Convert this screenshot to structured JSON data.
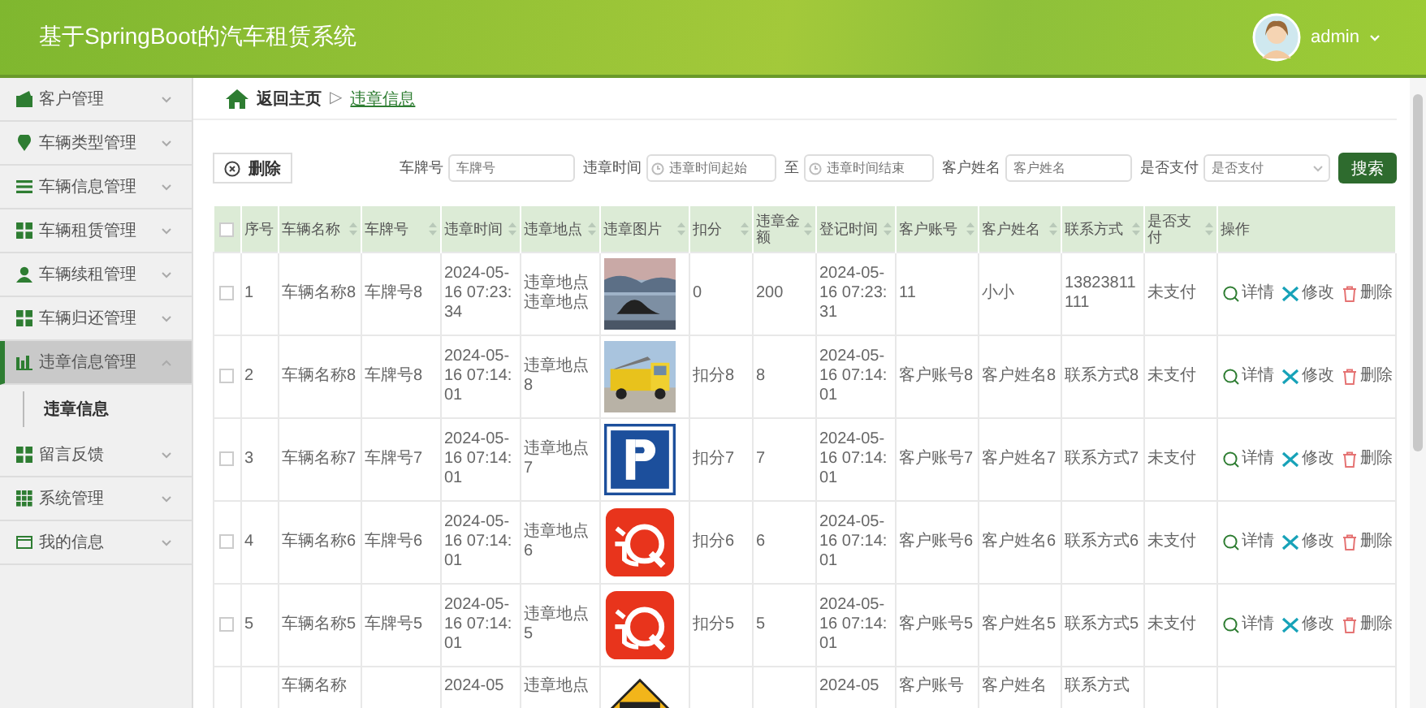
{
  "header": {
    "title": "基于SpringBoot的汽车租赁系统",
    "user": "admin"
  },
  "sidebar": {
    "items": [
      {
        "label": "客户管理",
        "expanded": false,
        "selected": false
      },
      {
        "label": "车辆类型管理",
        "expanded": false,
        "selected": false
      },
      {
        "label": "车辆信息管理",
        "expanded": false,
        "selected": false
      },
      {
        "label": "车辆租赁管理",
        "expanded": false,
        "selected": false
      },
      {
        "label": "车辆续租管理",
        "expanded": false,
        "selected": false
      },
      {
        "label": "车辆归还管理",
        "expanded": false,
        "selected": false
      },
      {
        "label": "违章信息管理",
        "expanded": true,
        "selected": true,
        "children": [
          {
            "label": "违章信息",
            "selected": true
          }
        ]
      },
      {
        "label": "留言反馈",
        "expanded": false,
        "selected": false
      },
      {
        "label": "系统管理",
        "expanded": false,
        "selected": false
      },
      {
        "label": "我的信息",
        "expanded": false,
        "selected": false
      }
    ]
  },
  "breadcrumb": {
    "home": "返回主页",
    "separator": "▷",
    "current": "违章信息"
  },
  "toolbar": {
    "delete_button": "删除",
    "filters": [
      {
        "label": "车牌号",
        "placeholder": "车牌号",
        "kind": "text"
      },
      {
        "label": "违章时间",
        "placeholder": "违章时间起始",
        "kind": "date"
      },
      {
        "label": "至",
        "placeholder": "违章时间结束",
        "kind": "date"
      },
      {
        "label": "客户姓名",
        "placeholder": "客户姓名",
        "kind": "text"
      },
      {
        "label": "是否支付",
        "placeholder": "是否支付",
        "kind": "select"
      }
    ],
    "search_button": "搜索"
  },
  "table": {
    "select_all": {
      "checked": false
    },
    "columns": [
      {
        "label": "序号",
        "sortable": false
      },
      {
        "label": "车辆名称",
        "sortable": true
      },
      {
        "label": "车牌号",
        "sortable": true
      },
      {
        "label": "违章时间",
        "sortable": true
      },
      {
        "label": "违章地点",
        "sortable": true
      },
      {
        "label": "违章图片",
        "sortable": true
      },
      {
        "label": "扣分",
        "sortable": true
      },
      {
        "label": "违章金额",
        "sortable": true
      },
      {
        "label": "登记时间",
        "sortable": true
      },
      {
        "label": "客户账号",
        "sortable": true
      },
      {
        "label": "客户姓名",
        "sortable": true
      },
      {
        "label": "联系方式",
        "sortable": true
      },
      {
        "label": "是否支付",
        "sortable": true
      },
      {
        "label": "操作",
        "sortable": false
      }
    ],
    "rows": [
      {
        "checked": false,
        "seq": "1",
        "car_name": "车辆名称8",
        "plate": "车牌号8",
        "time": "2024-05-16 07:23:34",
        "place": "违章地点违章地点",
        "points": "0",
        "amount": "200",
        "reg_time": "2024-05-16 07:23:31",
        "account": "11",
        "customer": "小小",
        "contact": "13823811111",
        "paid": "未支付",
        "actions": [
          {
            "kind": "detail",
            "label": "详情"
          },
          {
            "kind": "edit",
            "label": "修改"
          },
          {
            "kind": "delete",
            "label": "删除"
          }
        ]
      },
      {
        "checked": false,
        "seq": "2",
        "car_name": "车辆名称8",
        "plate": "车牌号8",
        "time": "2024-05-16 07:14:01",
        "place": "违章地点8",
        "points": "扣分8",
        "amount": "8",
        "reg_time": "2024-05-16 07:14:01",
        "account": "客户账号8",
        "customer": "客户姓名8",
        "contact": "联系方式8",
        "paid": "未支付",
        "actions": [
          {
            "kind": "detail",
            "label": "详情"
          },
          {
            "kind": "edit",
            "label": "修改"
          },
          {
            "kind": "delete",
            "label": "删除"
          }
        ]
      },
      {
        "checked": false,
        "seq": "3",
        "car_name": "车辆名称7",
        "plate": "车牌号7",
        "time": "2024-05-16 07:14:01",
        "place": "违章地点7",
        "points": "扣分7",
        "amount": "7",
        "reg_time": "2024-05-16 07:14:01",
        "account": "客户账号7",
        "customer": "客户姓名7",
        "contact": "联系方式7",
        "paid": "未支付",
        "actions": [
          {
            "kind": "detail",
            "label": "详情"
          },
          {
            "kind": "edit",
            "label": "修改"
          },
          {
            "kind": "delete",
            "label": "删除"
          }
        ]
      },
      {
        "checked": false,
        "seq": "4",
        "car_name": "车辆名称6",
        "plate": "车牌号6",
        "time": "2024-05-16 07:14:01",
        "place": "违章地点6",
        "points": "扣分6",
        "amount": "6",
        "reg_time": "2024-05-16 07:14:01",
        "account": "客户账号6",
        "customer": "客户姓名6",
        "contact": "联系方式6",
        "paid": "未支付",
        "actions": [
          {
            "kind": "detail",
            "label": "详情"
          },
          {
            "kind": "edit",
            "label": "修改"
          },
          {
            "kind": "delete",
            "label": "删除"
          }
        ]
      },
      {
        "checked": false,
        "seq": "5",
        "car_name": "车辆名称5",
        "plate": "车牌号5",
        "time": "2024-05-16 07:14:01",
        "place": "违章地点5",
        "points": "扣分5",
        "amount": "5",
        "reg_time": "2024-05-16 07:14:01",
        "account": "客户账号5",
        "customer": "客户姓名5",
        "contact": "联系方式5",
        "paid": "未支付",
        "actions": [
          {
            "kind": "detail",
            "label": "详情"
          },
          {
            "kind": "edit",
            "label": "修改"
          },
          {
            "kind": "delete",
            "label": "删除"
          }
        ]
      },
      {
        "car_name": "车辆名称",
        "time": "2024-05",
        "place": "违章地点",
        "reg_time": "2024-05",
        "account": "客户账号",
        "customer": "客户姓名",
        "contact": "联系方式"
      }
    ]
  }
}
